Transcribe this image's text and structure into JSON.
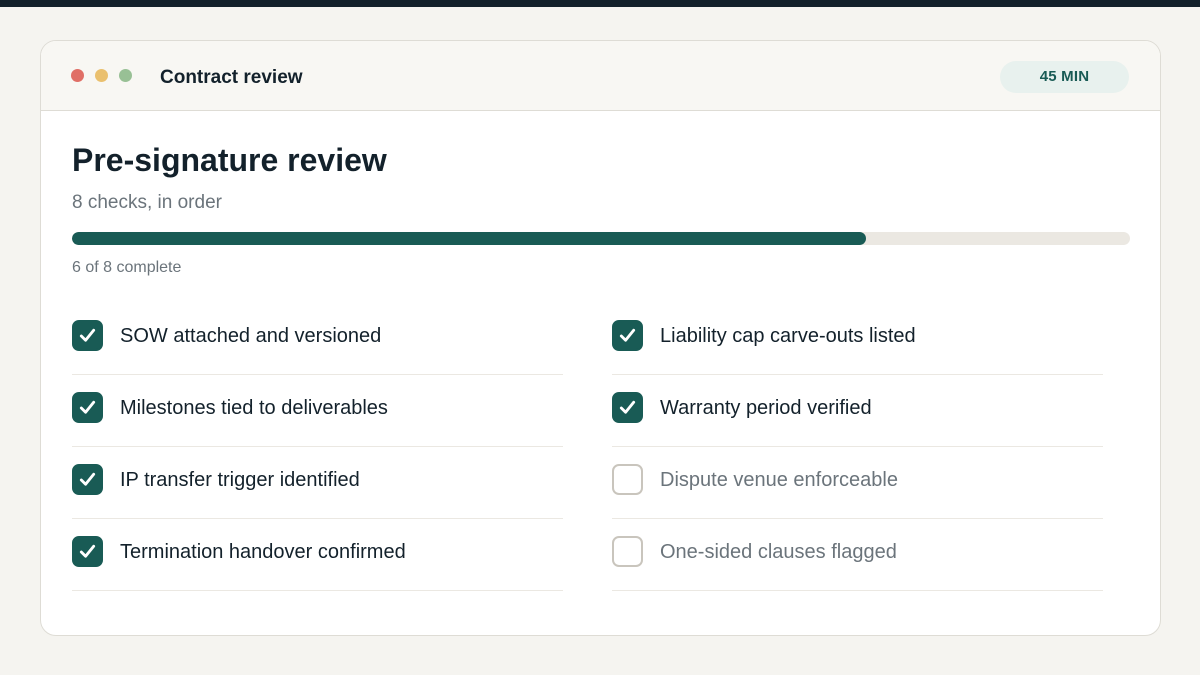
{
  "window": {
    "title": "Contract review",
    "duration_badge": "45 MIN"
  },
  "main": {
    "heading": "Pre-signature review",
    "subheading": "8 checks, in order",
    "progress": {
      "completed": 6,
      "total": 8,
      "fraction": 0.75,
      "label": "6 of 8 complete"
    },
    "checks_left": [
      {
        "label": "SOW attached and versioned",
        "checked": true
      },
      {
        "label": "Milestones tied to deliverables",
        "checked": true
      },
      {
        "label": "IP transfer trigger identified",
        "checked": true
      },
      {
        "label": "Termination handover confirmed",
        "checked": true
      }
    ],
    "checks_right": [
      {
        "label": "Liability cap carve-outs listed",
        "checked": true
      },
      {
        "label": "Warranty period verified",
        "checked": true
      },
      {
        "label": "Dispute venue enforceable",
        "checked": false
      },
      {
        "label": "One-sided clauses flagged",
        "checked": false
      }
    ]
  },
  "colors": {
    "accent": "#195b55",
    "top_bar": "#13212b",
    "dot_red": "#e06f66",
    "dot_yellow": "#eac06e",
    "dot_green": "#98c095"
  },
  "icons": {
    "checked_box": "checkmark-icon"
  }
}
